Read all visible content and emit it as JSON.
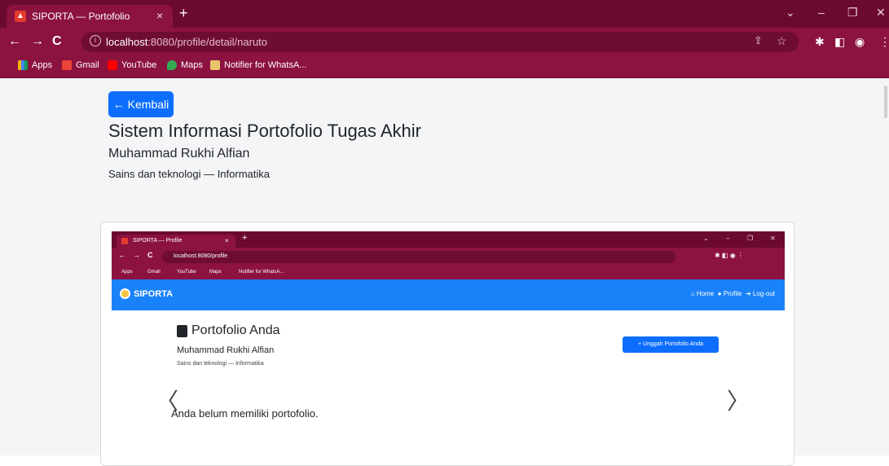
{
  "browser": {
    "tab_title": "SIPORTA — Portofolio",
    "tab_close": "×",
    "new_tab": "+",
    "url_host": "localhost",
    "url_path": ":8080/profile/detail/naruto",
    "window_controls": [
      "⌄",
      "–",
      "❐",
      "✕"
    ],
    "bookmarks": [
      "Apps",
      "Gmail",
      "YouTube",
      "Maps",
      "Notifier for WhatsA..."
    ]
  },
  "page": {
    "back_label": "← Kembali",
    "title": "Sistem Informasi Portofolio Tugas Akhir",
    "name": "Muhammad Rukhi Alfian",
    "faculty": "Sains dan teknologi — Informatika"
  },
  "inner": {
    "tab_title": "SIPORTA — Profile",
    "tab_close": "×",
    "new_tab": "+",
    "url": "localhost:8080/profile",
    "bookmarks": [
      "Apps",
      "Gmail",
      "YouTube",
      "Maps",
      "Notifier for WhatsA..."
    ],
    "brand": "SIPORTA",
    "nav_links": [
      "Home",
      "Profile",
      "Log-out"
    ],
    "heading": "Portofolio Anda",
    "name": "Muhammad Rukhi Alfian",
    "faculty": "Sains dan teknologi — Informatika",
    "upload_label": "+ Unggah Portofolio Anda",
    "empty_message": "Anda belum memiliki portofolio.",
    "prev_glyph": "〈",
    "next_glyph": "〉"
  },
  "colors": {
    "tab_bar": "#6b0a2e",
    "toolbar": "#8c1240",
    "primary": "#0d6efd",
    "inner_navbar": "#1a82f8"
  }
}
